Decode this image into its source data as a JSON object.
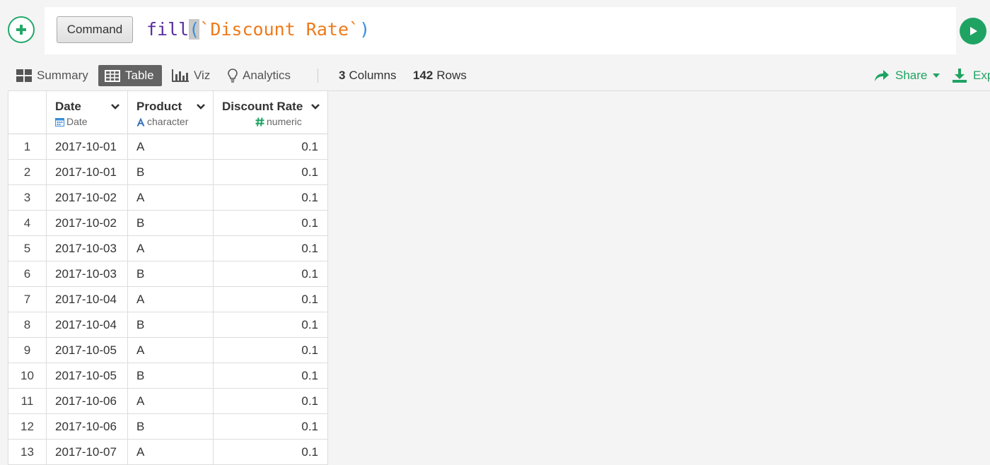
{
  "command_bar": {
    "label": "Command",
    "code": {
      "fn": "fill",
      "open_paren": "(",
      "arg": "`Discount Rate`",
      "close_paren": ")"
    }
  },
  "toolbar": {
    "summary_label": "Summary",
    "table_label": "Table",
    "viz_label": "Viz",
    "analytics_label": "Analytics",
    "columns_count": "3",
    "columns_label": "Columns",
    "rows_count": "142",
    "rows_label": "Rows",
    "share_label": "Share",
    "export_label": "Exp"
  },
  "colors": {
    "accent_green": "#1fa363",
    "active_tab": "#636363"
  },
  "table": {
    "columns": [
      {
        "name": "Date",
        "type": "Date",
        "type_icon": "calendar-icon"
      },
      {
        "name": "Product",
        "type": "character",
        "type_icon": "character-a-icon"
      },
      {
        "name": "Discount Rate",
        "type": "numeric",
        "type_icon": "hash-icon"
      }
    ],
    "rows": [
      {
        "idx": "1",
        "date": "2017-10-01",
        "product": "A",
        "rate": "0.1"
      },
      {
        "idx": "2",
        "date": "2017-10-01",
        "product": "B",
        "rate": "0.1"
      },
      {
        "idx": "3",
        "date": "2017-10-02",
        "product": "A",
        "rate": "0.1"
      },
      {
        "idx": "4",
        "date": "2017-10-02",
        "product": "B",
        "rate": "0.1"
      },
      {
        "idx": "5",
        "date": "2017-10-03",
        "product": "A",
        "rate": "0.1"
      },
      {
        "idx": "6",
        "date": "2017-10-03",
        "product": "B",
        "rate": "0.1"
      },
      {
        "idx": "7",
        "date": "2017-10-04",
        "product": "A",
        "rate": "0.1"
      },
      {
        "idx": "8",
        "date": "2017-10-04",
        "product": "B",
        "rate": "0.1"
      },
      {
        "idx": "9",
        "date": "2017-10-05",
        "product": "A",
        "rate": "0.1"
      },
      {
        "idx": "10",
        "date": "2017-10-05",
        "product": "B",
        "rate": "0.1"
      },
      {
        "idx": "11",
        "date": "2017-10-06",
        "product": "A",
        "rate": "0.1"
      },
      {
        "idx": "12",
        "date": "2017-10-06",
        "product": "B",
        "rate": "0.1"
      },
      {
        "idx": "13",
        "date": "2017-10-07",
        "product": "A",
        "rate": "0.1"
      }
    ]
  }
}
